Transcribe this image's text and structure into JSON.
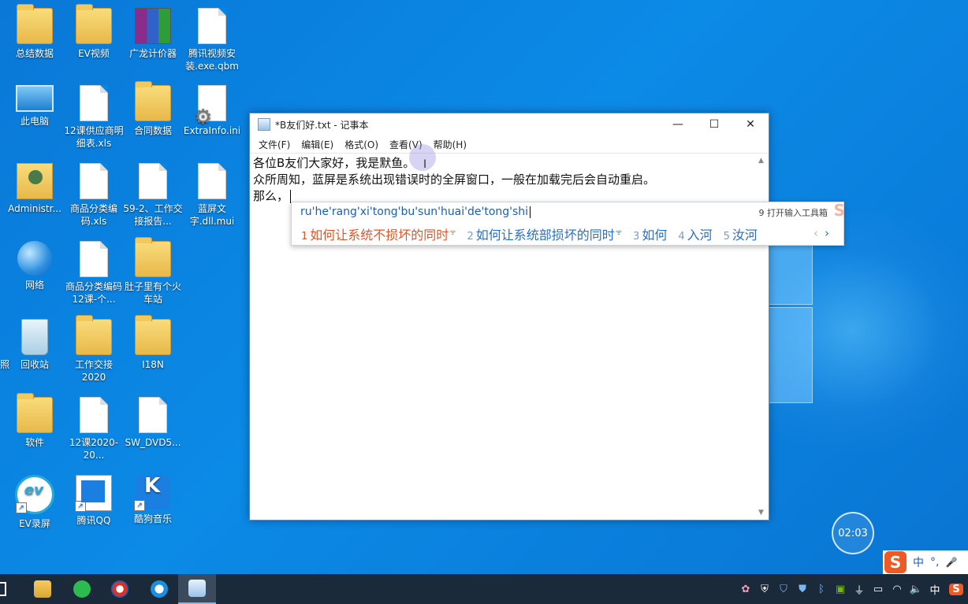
{
  "desktop": {
    "icons": [
      {
        "label": "总结数据",
        "icon": "folder-icon"
      },
      {
        "label": "EV视频",
        "icon": "folder-icon"
      },
      {
        "label": "广龙计价器",
        "icon": "archive-icon"
      },
      {
        "label": "腾讯视频安装.exe.qbm",
        "icon": "file-icon"
      },
      {
        "label": "此电脑",
        "icon": "computer-icon"
      },
      {
        "label": "12课供应商明细表.xls",
        "icon": "file-icon"
      },
      {
        "label": "合同数据",
        "icon": "folder-icon"
      },
      {
        "label": "ExtraInfo.ini",
        "icon": "settings-file-icon"
      },
      {
        "label": "Administr...",
        "icon": "user-folder-icon"
      },
      {
        "label": "商品分类编码.xls",
        "icon": "file-icon"
      },
      {
        "label": "59-2、工作交接报告...",
        "icon": "file-icon"
      },
      {
        "label": "蓝屏文字.dll.mui",
        "icon": "file-icon"
      },
      {
        "label": "网络",
        "icon": "network-icon"
      },
      {
        "label": "商品分类编码12课-个...",
        "icon": "file-icon"
      },
      {
        "label": "肚子里有个火车站",
        "icon": "folder-icon"
      },
      {
        "label": "回收站",
        "icon": "recycle-bin-icon"
      },
      {
        "label": "工作交接2020",
        "icon": "folder-icon"
      },
      {
        "label": "I18N",
        "icon": "folder-icon"
      },
      {
        "label": "软件",
        "icon": "folder-icon"
      },
      {
        "label": "12课2020-20...",
        "icon": "file-icon"
      },
      {
        "label": "SW_DVD5...",
        "icon": "file-icon"
      },
      {
        "label": "EV录屏",
        "icon": "ev-recorder-icon"
      },
      {
        "label": "腾讯QQ",
        "icon": "qq-icon"
      },
      {
        "label": "酷狗音乐",
        "icon": "kugou-icon"
      }
    ],
    "edge_label": "照"
  },
  "notepad": {
    "title": "*B友们好.txt - 记事本",
    "menu": [
      "文件(F)",
      "编辑(E)",
      "格式(O)",
      "查看(V)",
      "帮助(H)"
    ],
    "lines": [
      "各位B友们大家好，我是默鱼。",
      "众所周知，蓝屏是系统出现错误时的全屏窗口，一般在加载完后会自动重启。",
      "那么，"
    ]
  },
  "ime": {
    "pinyin": "ru'he'rang'xi'tong'bu'sun'huai'de'tong'shi",
    "toolbox": "9 打开输入工具箱",
    "candidates": [
      {
        "num": "1",
        "text": "如何让系统不损坏的同时"
      },
      {
        "num": "2",
        "text": "如何让系统部损坏的同时"
      },
      {
        "num": "3",
        "text": "如何"
      },
      {
        "num": "4",
        "text": "入河"
      },
      {
        "num": "5",
        "text": "汝河"
      }
    ],
    "logo": "S",
    "accent": "#d9582a"
  },
  "timer": "02:03",
  "imebar": {
    "logo": "S",
    "lang": "中",
    "punct": "°,",
    "mic": "🎤"
  },
  "tray": {
    "ime": "中"
  }
}
